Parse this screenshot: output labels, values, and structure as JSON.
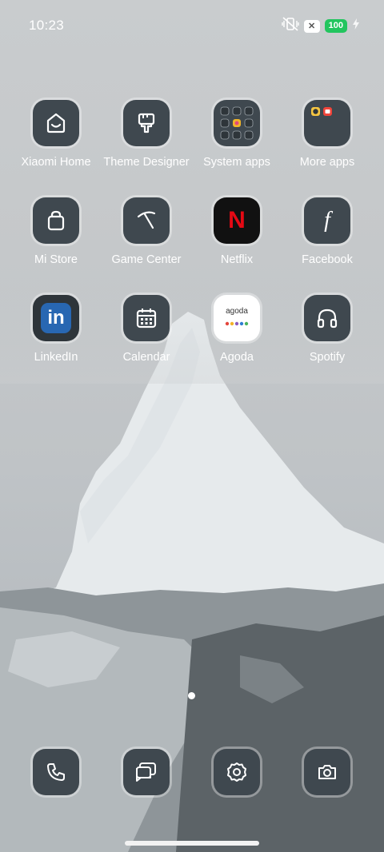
{
  "status_bar": {
    "time": "10:23",
    "x_badge": "✕",
    "battery": "100"
  },
  "apps": [
    {
      "name": "Xiaomi Home",
      "icon": "xiaomi-home-icon"
    },
    {
      "name": "Theme Designer",
      "icon": "theme-designer-icon"
    },
    {
      "name": "System apps",
      "icon": "system-apps-folder-icon"
    },
    {
      "name": "More apps",
      "icon": "more-apps-folder-icon"
    },
    {
      "name": "Mi Store",
      "icon": "mi-store-icon"
    },
    {
      "name": "Game Center",
      "icon": "game-center-icon"
    },
    {
      "name": "Netflix",
      "icon": "netflix-icon",
      "glyph": "N"
    },
    {
      "name": "Facebook",
      "icon": "facebook-icon",
      "glyph": "f"
    },
    {
      "name": "LinkedIn",
      "icon": "linkedin-icon",
      "glyph": "in"
    },
    {
      "name": "Calendar",
      "icon": "calendar-icon"
    },
    {
      "name": "Agoda",
      "icon": "agoda-icon",
      "glyph": "agoda"
    },
    {
      "name": "Spotify",
      "icon": "spotify-icon"
    }
  ],
  "dock": [
    {
      "icon": "phone-icon"
    },
    {
      "icon": "messages-icon"
    },
    {
      "icon": "settings-icon"
    },
    {
      "icon": "camera-icon"
    }
  ],
  "colors": {
    "netflix_red": "#e50914",
    "linkedin_blue": "#2867b2",
    "battery_green": "#22c55e",
    "icon_bg": "#3f484f"
  }
}
